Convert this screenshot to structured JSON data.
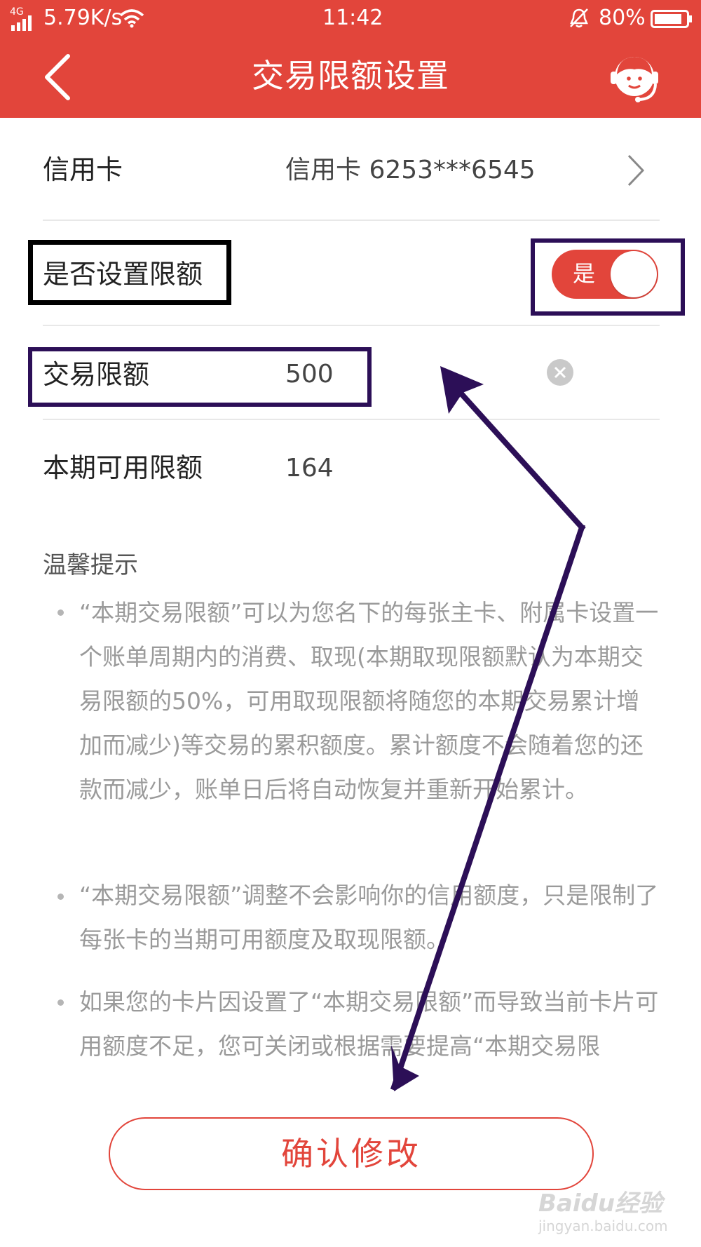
{
  "status_bar": {
    "network": "4G",
    "speed": "5.79K/s",
    "time": "11:42",
    "battery": "80%"
  },
  "header": {
    "title": "交易限额设置",
    "back_icon": "chevron-left-icon",
    "service_icon": "customer-service-icon"
  },
  "rows": {
    "card": {
      "label": "信用卡",
      "value": "信用卡 6253***6545"
    },
    "set_limit": {
      "label": "是否设置限额",
      "toggle_text": "是",
      "toggle_on": true
    },
    "trade_limit": {
      "label": "交易限额",
      "value": "500"
    },
    "available": {
      "label": "本期可用限额",
      "value": "164"
    }
  },
  "tips": {
    "title": "温馨提示",
    "items": [
      "“本期交易限额”可以为您名下的每张主卡、附属卡设置一个账单周期内的消费、取现(本期取现限额默认为本期交易限额的50%，可用取现限额将随您的本期交易累计增加而减少)等交易的累积额度。累计额度不会随着您的还款而减少，账单日后将自动恢复并重新开始累计。",
      " “本期交易限额”调整不会影响你的信用额度，只是限制了每张卡的当期可用额度及取现限额。",
      "如果您的卡片因设置了“本期交易限额”而导致当前卡片可用额度不足，您可关闭或根据需要提高“本期交易限"
    ]
  },
  "confirm_button": "确认修改",
  "watermark": {
    "main": "Baidu经验",
    "sub": "jingyan.baidu.com"
  },
  "colors": {
    "brand_red": "#e2453b",
    "annotation_black": "#000000",
    "annotation_purple": "#2c0f57"
  }
}
